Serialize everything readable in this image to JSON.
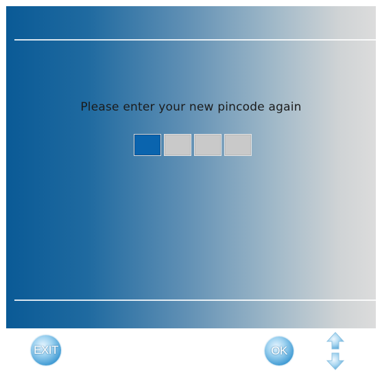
{
  "screen": {
    "prompt": "Please enter your new pincode again",
    "pin": {
      "length": 4,
      "active_index": 0
    },
    "colors": {
      "gradient_start": "#0a5a96",
      "gradient_end": "#dcdcdc",
      "pin_active": "#0a64ae",
      "pin_inactive": "#c9c9c9"
    }
  },
  "footer": {
    "exit_label": "EXIT",
    "ok_label": "OK",
    "up_icon": "arrow-up-icon",
    "down_icon": "arrow-down-icon"
  }
}
